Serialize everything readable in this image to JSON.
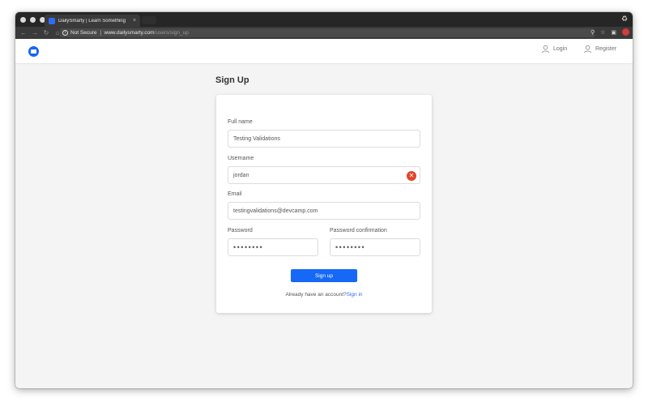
{
  "browser": {
    "tab_title": "DailySmarty | Learn Something",
    "tab_close": "×",
    "not_secure": "Not Secure",
    "url_host": "www.dailysmarty.com",
    "url_path": "/users/sign_up"
  },
  "header": {
    "login_label": "Login",
    "register_label": "Register"
  },
  "page": {
    "title": "Sign Up"
  },
  "form": {
    "fullname_label": "Full name",
    "fullname_value": "Testing Validations",
    "username_label": "Username",
    "username_value": "jordan",
    "email_label": "Email",
    "email_value": "testingvalidations@devcamp.com",
    "password_label": "Password",
    "password_value": "••••••••",
    "password_confirmation_label": "Password confirmation",
    "password_confirmation_value": "••••••••",
    "submit_label": "Sign up",
    "signin_prompt": "Already have an account?",
    "signin_link": "Sign in"
  },
  "colors": {
    "brand": "#1665f5",
    "error": "#e2452a"
  }
}
